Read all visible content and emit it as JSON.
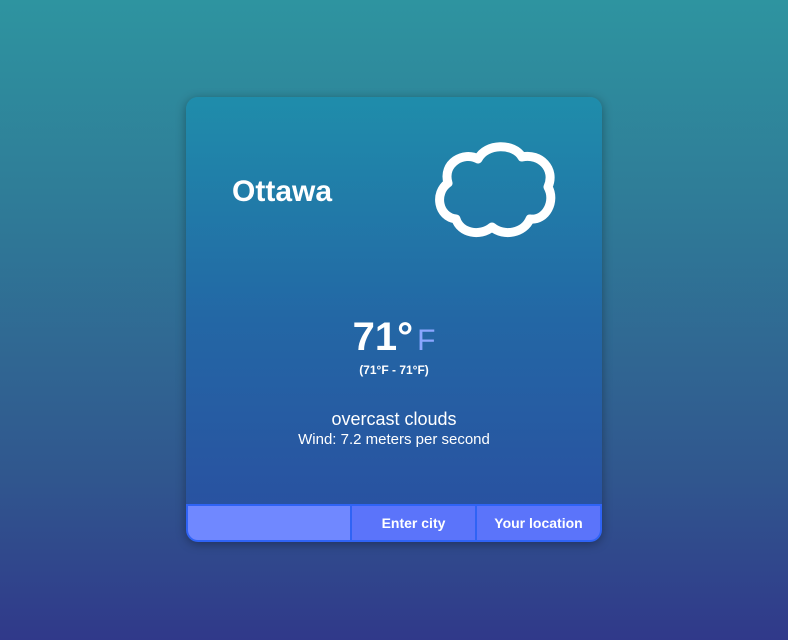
{
  "weather": {
    "city": "Ottawa",
    "icon": "cloud-icon",
    "temperature": "71°",
    "unit": "F",
    "range": "(71°F - 71°F)",
    "description": "overcast clouds",
    "wind": "Wind: 7.2 meters per second"
  },
  "controls": {
    "city_input_value": "",
    "city_input_placeholder": "",
    "enter_city_label": "Enter city",
    "your_location_label": "Your location"
  },
  "colors": {
    "accent": "#5b74fa",
    "unit": "#8aa6ff",
    "border": "#2f63f5"
  }
}
